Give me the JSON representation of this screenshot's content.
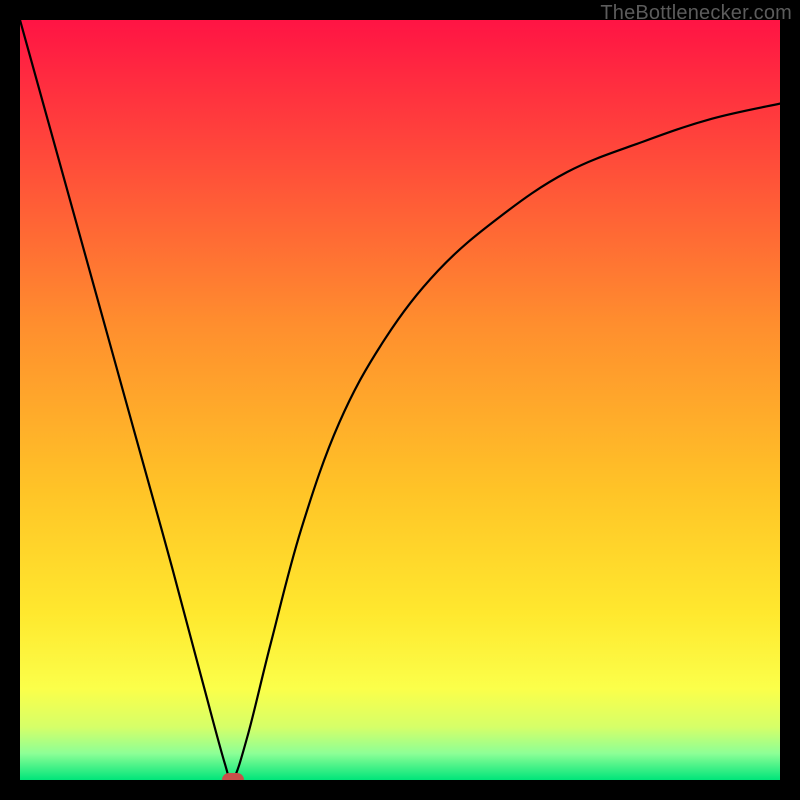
{
  "watermark": "TheBottlenecker.com",
  "chart_data": {
    "type": "line",
    "title": "",
    "xlabel": "",
    "ylabel": "",
    "xlim": [
      0,
      100
    ],
    "ylim": [
      0,
      100
    ],
    "series": [
      {
        "name": "bottleneck-curve",
        "x": [
          0,
          5,
          10,
          15,
          20,
          24,
          27,
          28,
          30,
          33,
          37,
          42,
          48,
          55,
          63,
          72,
          82,
          91,
          100
        ],
        "values": [
          100,
          82,
          64,
          46,
          28,
          13,
          2,
          0,
          6,
          18,
          33,
          47,
          58,
          67,
          74,
          80,
          84,
          87,
          89
        ]
      }
    ],
    "marker": {
      "x": 28,
      "y": 0,
      "color": "#c84f49"
    },
    "gradient_stops": [
      {
        "offset": 0.0,
        "color": "#ff1444"
      },
      {
        "offset": 0.18,
        "color": "#ff4a3a"
      },
      {
        "offset": 0.4,
        "color": "#ff8e2e"
      },
      {
        "offset": 0.62,
        "color": "#ffc427"
      },
      {
        "offset": 0.78,
        "color": "#ffe82e"
      },
      {
        "offset": 0.88,
        "color": "#fbff4a"
      },
      {
        "offset": 0.93,
        "color": "#d6ff68"
      },
      {
        "offset": 0.965,
        "color": "#8dff96"
      },
      {
        "offset": 1.0,
        "color": "#00e57a"
      }
    ]
  }
}
